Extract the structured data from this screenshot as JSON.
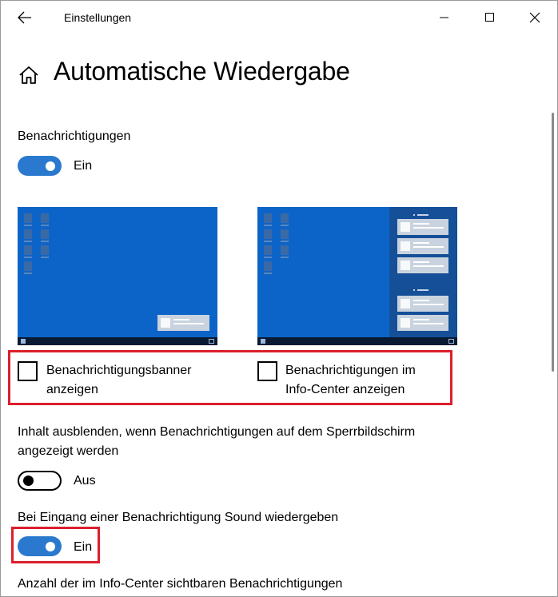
{
  "window": {
    "app_title": "Einstellungen",
    "back_icon": "back-arrow-icon",
    "minimize_icon": "minimize-icon",
    "maximize_icon": "maximize-icon",
    "close_icon": "close-icon"
  },
  "header": {
    "home_icon": "home-icon",
    "title": "Automatische Wiedergabe"
  },
  "notifications": {
    "label": "Benachrichtigungen",
    "toggle_state": "on",
    "toggle_text": "Ein"
  },
  "checkboxes": [
    {
      "label_line1": "Benachrichtigungsbanner",
      "label_line2": "anzeigen",
      "checked": false
    },
    {
      "label_line1": "Benachrichtigungen im",
      "label_line2": "Info-Center anzeigen",
      "checked": false
    }
  ],
  "hide_content": {
    "label_line1": "Inhalt ausblenden, wenn Benachrichtigungen auf dem Sperrbildschirm",
    "label_line2": "angezeigt werden",
    "toggle_state": "off",
    "toggle_text": "Aus"
  },
  "sound": {
    "label": "Bei Eingang einer Benachrichtigung Sound wiedergeben",
    "toggle_state": "on",
    "toggle_text": "Ein"
  },
  "count": {
    "label": "Anzahl der im Info-Center sichtbaren Benachrichtigungen"
  },
  "colors": {
    "accent": "#2b79cf",
    "highlight": "#dc1f2d",
    "preview_bg": "#0d64c8"
  }
}
